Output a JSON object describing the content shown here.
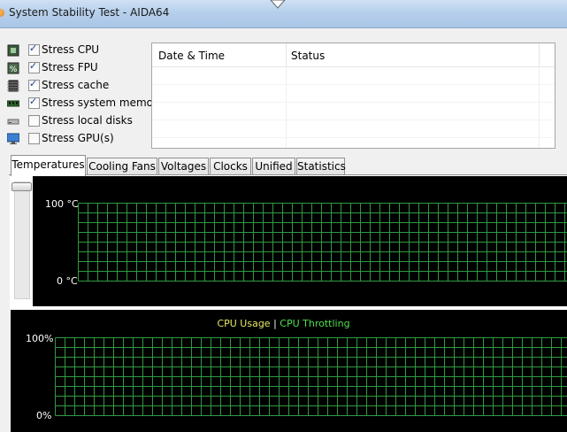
{
  "window": {
    "title": "System Stability Test - AIDA64"
  },
  "stress_options": [
    {
      "label": "Stress CPU",
      "checked": true,
      "icon": "cpu-chip-icon"
    },
    {
      "label": "Stress FPU",
      "checked": true,
      "icon": "fpu-chip-icon"
    },
    {
      "label": "Stress cache",
      "checked": true,
      "icon": "cache-chip-icon"
    },
    {
      "label": "Stress system memory",
      "checked": true,
      "icon": "memory-module-icon"
    },
    {
      "label": "Stress local disks",
      "checked": false,
      "icon": "hard-disk-icon"
    },
    {
      "label": "Stress GPU(s)",
      "checked": false,
      "icon": "monitor-gpu-icon"
    }
  ],
  "status_table": {
    "columns": [
      "Date & Time",
      "Status"
    ],
    "rows": []
  },
  "tabs": [
    {
      "label": "Temperatures",
      "active": true
    },
    {
      "label": "Cooling Fans",
      "active": false
    },
    {
      "label": "Voltages",
      "active": false
    },
    {
      "label": "Clocks",
      "active": false
    },
    {
      "label": "Unified",
      "active": false
    },
    {
      "label": "Statistics",
      "active": false
    }
  ],
  "temperature_graph": {
    "y_max_label": "100 °C",
    "y_min_label": "0 °C",
    "grid_color": "#2f9a3f"
  },
  "cpu_graph": {
    "legend_usage": "CPU Usage",
    "legend_separator": "|",
    "legend_throttling": "CPU Throttling",
    "y_max_label": "100%",
    "y_min_label": "0%",
    "usage_color": "#e7e76a",
    "throttling_color": "#4ee14e",
    "grid_color": "#2f9a3f"
  }
}
